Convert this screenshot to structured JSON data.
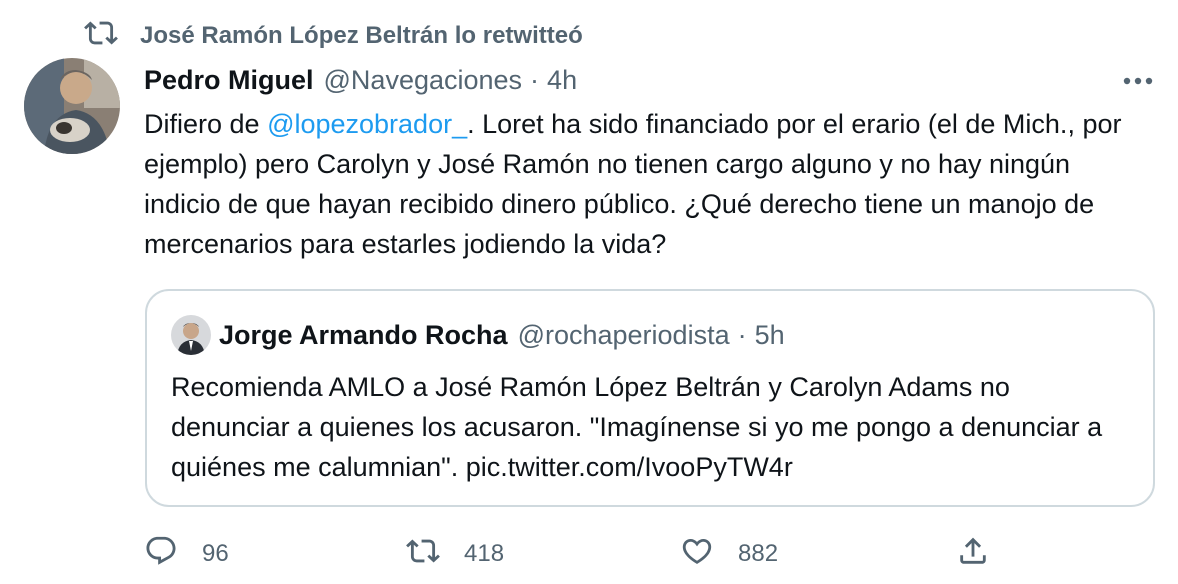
{
  "retweet_context": {
    "icon": "retweet-icon",
    "label": "José Ramón López Beltrán lo retwitteó"
  },
  "tweet": {
    "author_name": "Pedro Miguel",
    "author_handle": "@Navegaciones",
    "separator": "·",
    "time": "4h",
    "text_before_mention": "Difiero de ",
    "mention": "@lopezobrador_",
    "text_after_mention": ". Loret ha sido financiado por el erario (el de Mich., por ejemplo) pero Carolyn y José Ramón no tienen cargo alguno y no hay ningún indicio de que hayan recibido dinero público. ¿Qué derecho tiene un manojo de mercenarios para estarles jodiendo la vida?",
    "mention_color": "#1d9bf0"
  },
  "quoted_tweet": {
    "author_name": "Jorge Armando Rocha",
    "author_handle": "@rochaperiodista",
    "separator": "·",
    "time": "5h",
    "text": "Recomienda AMLO a José Ramón López Beltrán y Carolyn Adams no denunciar a quienes los acusaron. \"Imagínense si yo me pongo a denunciar a quiénes me calumnian\". pic.twitter.com/IvooPyTW4r"
  },
  "actions": {
    "reply_count": "96",
    "retweet_count": "418",
    "like_count": "882"
  },
  "colors": {
    "text_primary": "#0f1419",
    "text_secondary": "#536471",
    "link": "#1d9bf0",
    "border": "#cfd9de"
  }
}
